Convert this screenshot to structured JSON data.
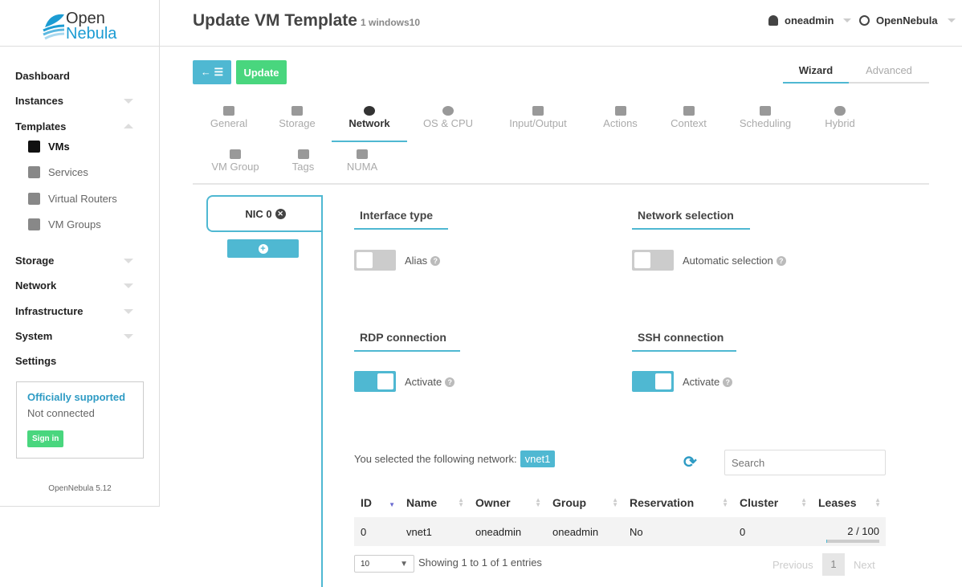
{
  "logo": {
    "line1": "Open",
    "line2": "Nebula"
  },
  "header": {
    "title": "Update VM Template",
    "subtitle": "1 windows10",
    "user": "oneadmin",
    "zone": "OpenNebula"
  },
  "sidebar": {
    "items": [
      {
        "label": "Dashboard"
      },
      {
        "label": "Instances"
      },
      {
        "label": "Templates"
      },
      {
        "label": "Storage"
      },
      {
        "label": "Network"
      },
      {
        "label": "Infrastructure"
      },
      {
        "label": "System"
      },
      {
        "label": "Settings"
      }
    ],
    "sub": [
      {
        "label": "VMs"
      },
      {
        "label": "Services"
      },
      {
        "label": "Virtual Routers"
      },
      {
        "label": "VM Groups"
      }
    ],
    "support": {
      "title": "Officially supported",
      "status": "Not connected",
      "signin": "Sign in"
    },
    "version": "OpenNebula 5.12"
  },
  "toolbar": {
    "update": "Update",
    "wizard": "Wizard",
    "advanced": "Advanced"
  },
  "tabs": [
    {
      "label": "General"
    },
    {
      "label": "Storage"
    },
    {
      "label": "Network"
    },
    {
      "label": "OS & CPU"
    },
    {
      "label": "Input/Output"
    },
    {
      "label": "Actions"
    },
    {
      "label": "Context"
    },
    {
      "label": "Scheduling"
    },
    {
      "label": "Hybrid"
    },
    {
      "label": "VM Group"
    },
    {
      "label": "Tags"
    },
    {
      "label": "NUMA"
    }
  ],
  "nic": {
    "label": "NIC 0"
  },
  "sections": {
    "interface": "Interface type",
    "alias": "Alias",
    "netsel": "Network selection",
    "auto": "Automatic selection",
    "rdp": "RDP connection",
    "rdp_act": "Activate",
    "ssh": "SSH connection",
    "ssh_act": "Activate"
  },
  "toggles": {
    "alias": false,
    "auto": false,
    "rdp": true,
    "ssh": true
  },
  "selected": {
    "text": "You selected the following network:",
    "value": "vnet1"
  },
  "search": {
    "placeholder": "Search"
  },
  "table": {
    "headers": [
      "ID",
      "Name",
      "Owner",
      "Group",
      "Reservation",
      "Cluster",
      "Leases"
    ],
    "rows": [
      [
        "0",
        "vnet1",
        "oneadmin",
        "oneadmin",
        "No",
        "0",
        "2 / 100"
      ]
    ],
    "leases_fraction": 0.02,
    "page_size": "10",
    "info": "Showing 1 to 1 of 1 entries",
    "prev": "Previous",
    "page": "1",
    "next": "Next"
  },
  "colors": {
    "accent": "#4fb8d2",
    "green": "#49d67e"
  }
}
